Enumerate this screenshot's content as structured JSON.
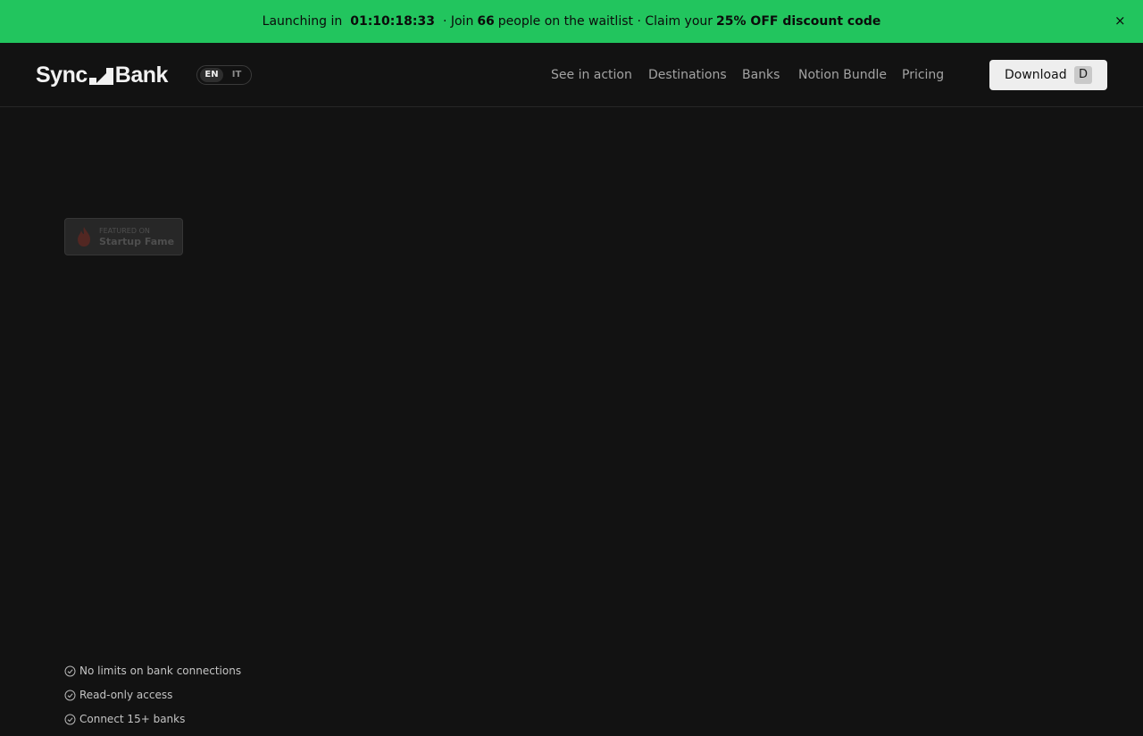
{
  "banner": {
    "prefix": "Launching in",
    "countdown": "01:10:18:33",
    "join_text": "· Join",
    "count": "66",
    "waitlist_text": "people on the waitlist · Claim your",
    "discount": "25% OFF discount code",
    "close_label": "×",
    "color": "#22c55e"
  },
  "header": {
    "logo_left": "Sync",
    "logo_right": "Bank",
    "lang": {
      "active": "EN",
      "inactive": "IT"
    },
    "nav": [
      "See in action",
      "Destinations",
      "Banks",
      "Notion Bundle",
      "Pricing"
    ],
    "download_label": "Download",
    "download_shortcut": "D"
  },
  "badge": {
    "small": "FEATURED ON",
    "big": "Startup Fame"
  },
  "features": [
    "No limits on bank connections",
    "Read-only access",
    "Connect 15+ banks"
  ],
  "icons": {
    "close": "close-icon",
    "logo_mark": "logo-mark-icon",
    "flame": "flame-icon",
    "check": "check-circle-icon"
  }
}
